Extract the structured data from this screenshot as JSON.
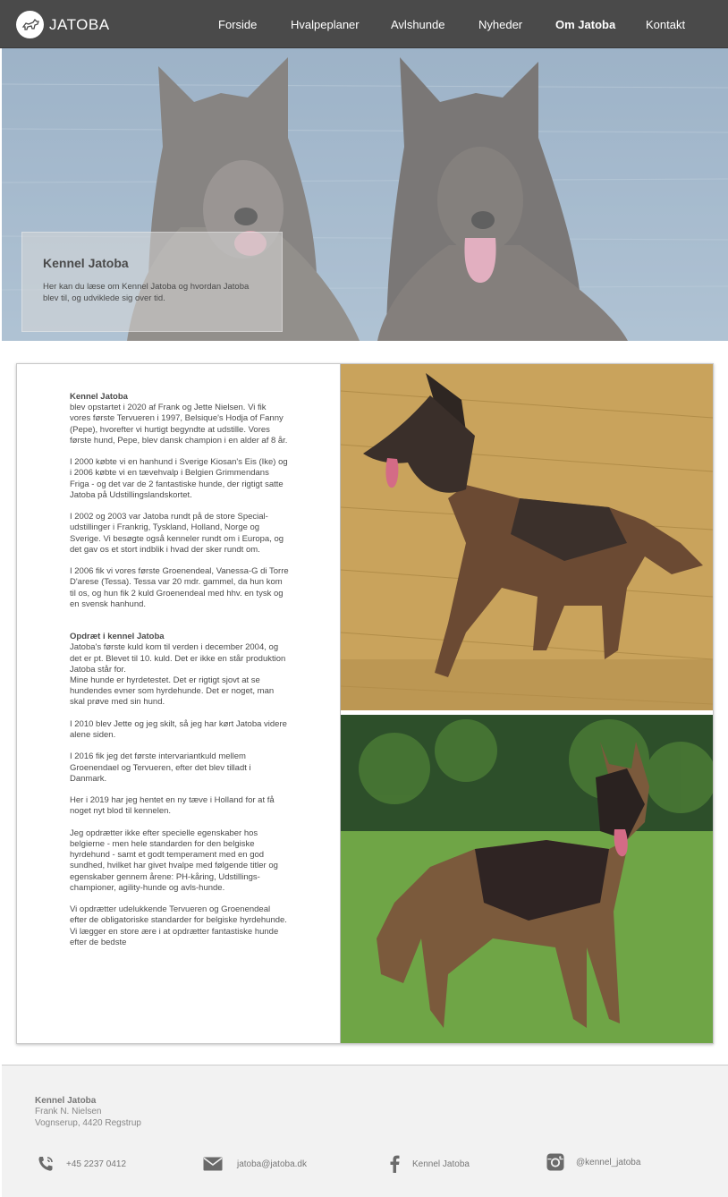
{
  "nav": {
    "logo_text": "JATOBA",
    "items": [
      {
        "label": "Forside"
      },
      {
        "label": "Hvalpeplaner"
      },
      {
        "label": "Avlshunde"
      },
      {
        "label": "Nyheder"
      },
      {
        "label": "Om Jatoba",
        "active": true
      },
      {
        "label": "Kontakt"
      }
    ]
  },
  "hero": {
    "title": "Kennel Jatoba",
    "text": "Her kan du læse om Kennel Jatoba og hvordan Jatoba blev til, og udviklede sig over tid."
  },
  "article": {
    "section1_heading": "Kennel Jatoba",
    "p1": "blev opstartet i 2020 af Frank og Jette Nielsen. Vi fik vores første Tervueren i 1997, Belsique's Hodja of Fanny (Pepe), hvorefter vi hurtigt begyndte at udstille. Vores første hund, Pepe, blev dansk champion i en alder af 8 år.",
    "p2": "I 2000 købte vi en hanhund i Sverige Kiosan's Eis (Ike) og i 2006 købte vi en tævehvalp i Belgien Grimmendans Friga - og det var de 2 fantastiske hunde, der rigtigt satte Jatoba på Udstillingslandskortet.",
    "p3": "I 2002 og 2003 var Jatoba rundt på de store Special-udstillinger i Frankrig, Tyskland, Holland, Norge og Sverige. Vi besøgte også kenneler rundt om i Europa, og det gav os et stort indblik i hvad der sker rundt om.",
    "p4": "I 2006 fik vi vores første Groenendeal, Vanessa-G di Torre D'arese (Tessa). Tessa var 20 mdr. gammel, da hun kom til os, og hun fik 2 kuld Groenendeal med hhv. en tysk og en svensk hanhund.",
    "section2_heading": "Opdræt i kennel Jatoba",
    "p5": "Jatoba's første kuld kom til verden i december 2004, og det er pt. Blevet til 10. kuld. Det er ikke en står produktion Jatoba står for.",
    "p5b": "Mine hunde er hyrdetestet. Det er rigtigt sjovt at se hundendes evner som hyrdehunde. Det er noget, man skal prøve med sin hund.",
    "p6": "I 2010 blev Jette og jeg skilt, så jeg har kørt Jatoba videre alene siden.",
    "p7": "I 2016 fik jeg det første intervariantkuld mellem Groenendael og Tervueren, efter det blev tilladt i Danmark.",
    "p8": "Her i 2019 har jeg hentet en ny tæve i Holland for at få noget nyt blod til kennelen.",
    "p9": "Jeg opdrætter ikke efter specielle egenskaber hos belgierne - men hele standarden for den belgiske hyrdehund - samt et godt temperament med en god sundhed, hvilket har givet hvalpe med følgende titler og egenskaber gennem årene: PH-kåring, Udstillings-championer, agility-hunde og avls-hunde.",
    "p10": "Vi opdrætter udelukkende Tervueren og Groenendeal efter de obligatoriske standarder for belgiske hyrdehunde. Vi lægger en store ære i at opdrætter fantastiske hunde efter de bedste"
  },
  "footer": {
    "name": "Kennel Jatoba",
    "person": "Frank N. Nielsen",
    "address": "Vognserup, 4420 Regstrup",
    "phone": "+45 2237 0412",
    "email": "jatoba@jatoba.dk",
    "facebook": "Kennel Jatoba",
    "instagram": "@kennel_jatoba"
  },
  "icons": [
    "logo-dog-icon",
    "phone-icon",
    "mail-icon",
    "facebook-icon",
    "instagram-icon"
  ],
  "colors": {
    "nav_bg": "#4a4a4a",
    "footer_bg": "#f2f2f2",
    "text": "#4a4a4a"
  }
}
